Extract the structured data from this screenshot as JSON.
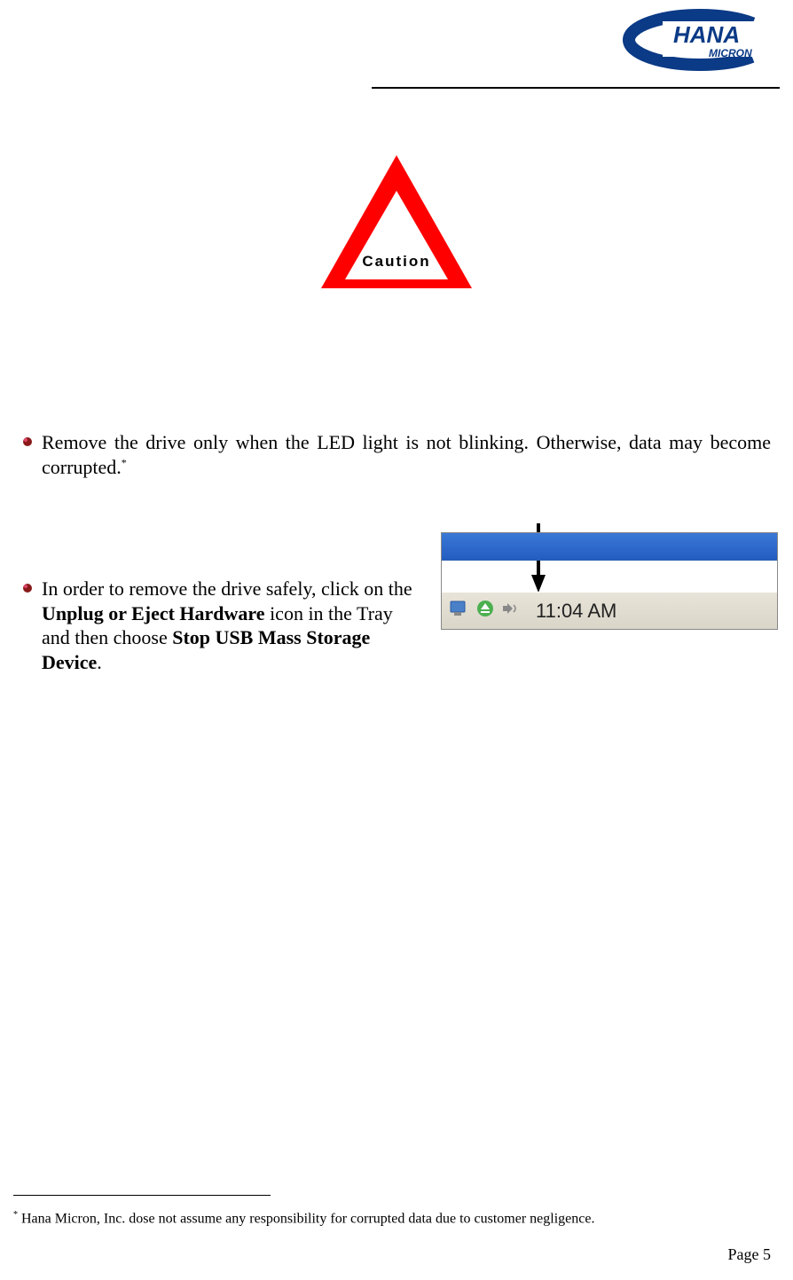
{
  "logo": {
    "brand": "HANA",
    "sub": "MICRON"
  },
  "caution": {
    "label": "Caution"
  },
  "bullets": {
    "b1_pre": "Remove the drive only when the LED light is not blinking.  Otherwise, data may become corrupted.",
    "b1_sup": "*",
    "b2_a": "In order to remove the drive safely, click on the ",
    "b2_bold1": "Unplug or Eject Hardware",
    "b2_b": " icon in the Tray and then choose ",
    "b2_bold2": "Stop USB Mass Storage Device",
    "b2_c": "."
  },
  "taskbar": {
    "time": "11:04 AM"
  },
  "footnote": {
    "sup": "*",
    "text": " Hana Micron, Inc. dose not assume any responsibility for corrupted data due to customer negligence."
  },
  "page_number": "Page 5"
}
